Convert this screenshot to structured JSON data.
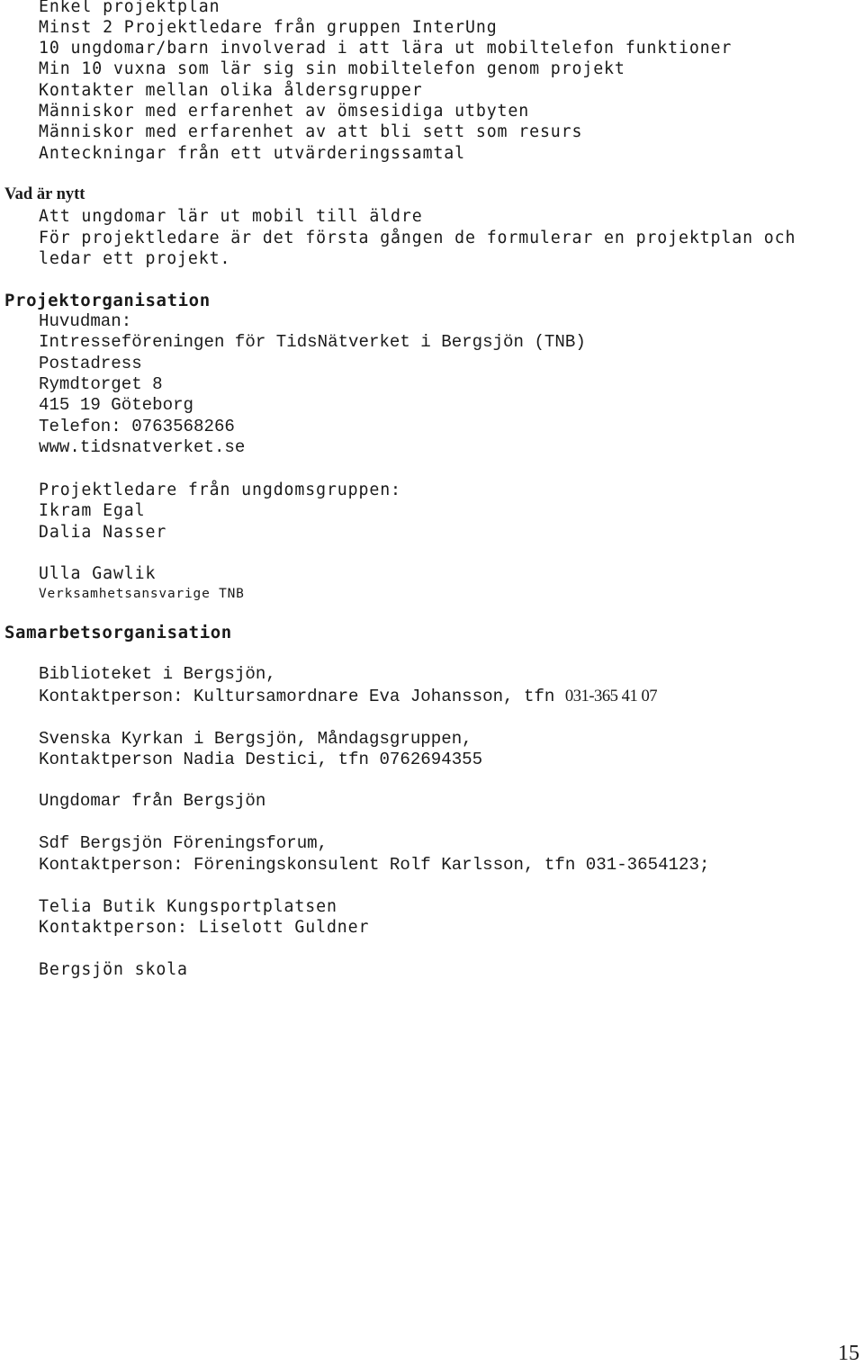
{
  "intro_lines": [
    "Enkel projektplan",
    "Minst 2 Projektledare från gruppen InterUng",
    "10 ungdomar/barn involverad i att lära ut mobiltelefon funktioner",
    "Min 10 vuxna som lär sig sin mobiltelefon genom projekt",
    "Kontakter mellan olika åldersgrupper",
    "Människor med erfarenhet av ömsesidiga utbyten",
    "Människor med erfarenhet av att bli sett som resurs",
    "Anteckningar från ett utvärderingssamtal"
  ],
  "vad_ar_nytt": {
    "heading": "Vad är nytt",
    "lines": [
      "Att ungdomar lär ut mobil till äldre",
      "För projektledare är det första gången de formulerar en projektplan och",
      "ledar ett projekt."
    ]
  },
  "projektorganisation": {
    "heading": "Projektorganisation",
    "lines": [
      "Huvudman:",
      "Intresseföreningen för TidsNätverket i Bergsjön (TNB)",
      "Postadress",
      "Rymdtorget 8",
      "415 19 Göteborg",
      "Telefon: 0763568266",
      "www.tidsnatverket.se"
    ],
    "leaders_label": "Projektledare från ungdomsgruppen:",
    "leaders": [
      "Ikram Egal",
      "Dalia Nasser"
    ],
    "manager_name": "Ulla Gawlik",
    "manager_role": "Verksamhetsansvarige TNB"
  },
  "samarbetsorganisation": {
    "heading": "Samarbetsorganisation",
    "partners": [
      {
        "name": "Biblioteket i Bergsjön,",
        "contact": "Kontaktperson: Kultursamordnare Eva Johansson, tfn ",
        "phone": "031-365 41 07"
      },
      {
        "name": "Svenska Kyrkan i Bergsjön, Måndagsgruppen,",
        "contact": "Kontaktperson Nadia Destici, tfn 0762694355"
      },
      {
        "name": "Ungdomar från Bergsjön"
      },
      {
        "name": "Sdf Bergsjön Föreningsforum,",
        "contact": "Kontaktperson: Föreningskonsulent Rolf Karlsson, tfn 031-3654123;"
      },
      {
        "name": "Telia Butik Kungsportplatsen",
        "contact": "Kontaktperson: Liselott Guldner"
      },
      {
        "name": "Bergsjön skola"
      }
    ]
  },
  "page_number": "15"
}
